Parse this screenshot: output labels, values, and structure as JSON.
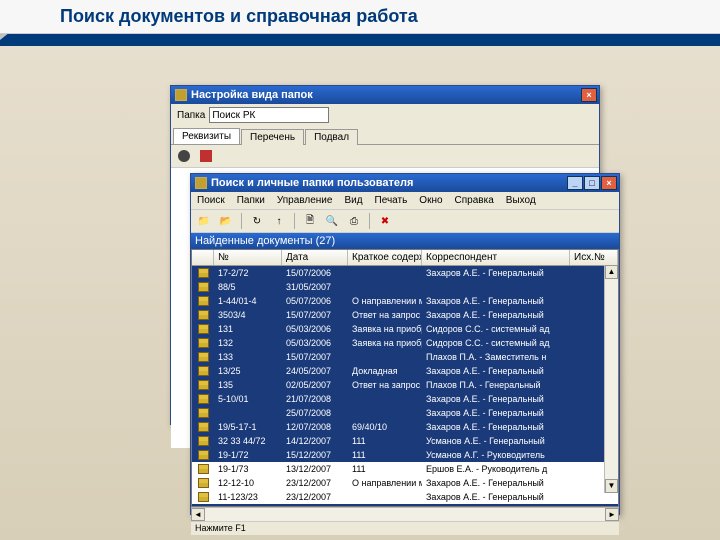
{
  "page": {
    "title": "Поиск документов и справочная работа"
  },
  "window_back": {
    "title": "Настройка вида папок",
    "form": {
      "label": "Папка",
      "value": "Поиск РК"
    },
    "tabs": [
      "Реквизиты",
      "Перечень",
      "Подвал"
    ],
    "toolbar_icons": [
      "bullet",
      "bullet2",
      "color-red"
    ]
  },
  "window_front": {
    "title": "Поиск и личные папки пользователя",
    "minimize": "_",
    "maximize": "□",
    "close": "×",
    "menu": [
      "Поиск",
      "Папки",
      "Управление",
      "Вид",
      "Печать",
      "Окно",
      "Справка",
      "Выход"
    ],
    "toolbar": [
      "folder-icon",
      "folder-open-icon",
      "sep",
      "refresh-icon",
      "up-arrow-icon",
      "sep",
      "doc-icon",
      "find-icon",
      "print-icon",
      "sep",
      "delete-icon"
    ],
    "inner_title": "Найденные документы (27)",
    "columns": [
      "",
      "№",
      "Дата",
      "Краткое содержание",
      "Корреспондент",
      "Исх.№"
    ],
    "rows": [
      {
        "sel": true,
        "num": "17-2/72",
        "date": "15/07/2006",
        "desc": "",
        "who": "Захаров А.Е. - Генеральный"
      },
      {
        "sel": true,
        "num": "88/5",
        "date": "31/05/2007",
        "desc": "",
        "who": ""
      },
      {
        "sel": true,
        "num": "1-44/01-4",
        "date": "05/07/2006",
        "desc": "О направлении материалов",
        "who": "Захаров А.Е. - Генеральный"
      },
      {
        "sel": true,
        "num": "3503/4",
        "date": "15/07/2007",
        "desc": "Ответ на запрос из Минсвязи РФ",
        "who": "Захаров А.Е. - Генеральный"
      },
      {
        "sel": true,
        "num": "131",
        "date": "05/03/2006",
        "desc": "Заявка на приобретение",
        "who": "Сидоров С.С. - системный ад"
      },
      {
        "sel": true,
        "num": "132",
        "date": "05/03/2006",
        "desc": "Заявка на приобретение",
        "who": "Сидоров С.С. - системный ад"
      },
      {
        "sel": true,
        "num": "133",
        "date": "15/07/2007",
        "desc": "",
        "who": "Плахов П.А. - Заместитель н"
      },
      {
        "sel": true,
        "num": "13/25",
        "date": "24/05/2007",
        "desc": "Докладная",
        "who": "Захаров А.Е. - Генеральный"
      },
      {
        "sel": true,
        "num": "135",
        "date": "02/05/2007",
        "desc": "Ответ на запрос",
        "who": "Плахов П.А. - Генеральный"
      },
      {
        "sel": true,
        "num": "5-10/01",
        "date": "21/07/2008",
        "desc": "",
        "who": "Захаров А.Е. - Генеральный"
      },
      {
        "sel": true,
        "num": "",
        "date": "25/07/2008",
        "desc": "",
        "who": "Захаров А.Е. - Генеральный"
      },
      {
        "sel": true,
        "num": "19/5-17-1",
        "date": "12/07/2008",
        "desc": "69/40/10",
        "who": "Захаров А.Е. - Генеральный"
      },
      {
        "sel": true,
        "num": "32 33 44/72",
        "date": "14/12/2007",
        "desc": "111",
        "who": "Усманов А.Е. - Генеральный"
      },
      {
        "sel": true,
        "num": "19-1/72",
        "date": "15/12/2007",
        "desc": "111",
        "who": "Усманов А.Г. - Руководитель"
      },
      {
        "sel": false,
        "num": "19-1/73",
        "date": "13/12/2007",
        "desc": "111",
        "who": "Ершов Е.А. - Руководитель д"
      },
      {
        "sel": false,
        "num": "12-12-10",
        "date": "23/12/2007",
        "desc": "О направлении материалов",
        "who": "Захаров А.Е. - Генеральный"
      },
      {
        "sel": false,
        "num": "11-123/23",
        "date": "23/12/2007",
        "desc": "",
        "who": "Захаров А.Е. - Генеральный"
      }
    ],
    "status": "Нажмите F1"
  },
  "icons": {
    "folder": "📁",
    "folder_open": "📂",
    "refresh": "↻",
    "up": "↑",
    "doc": "🗎",
    "find": "🔍",
    "print": "⎙",
    "delete": "✖"
  }
}
